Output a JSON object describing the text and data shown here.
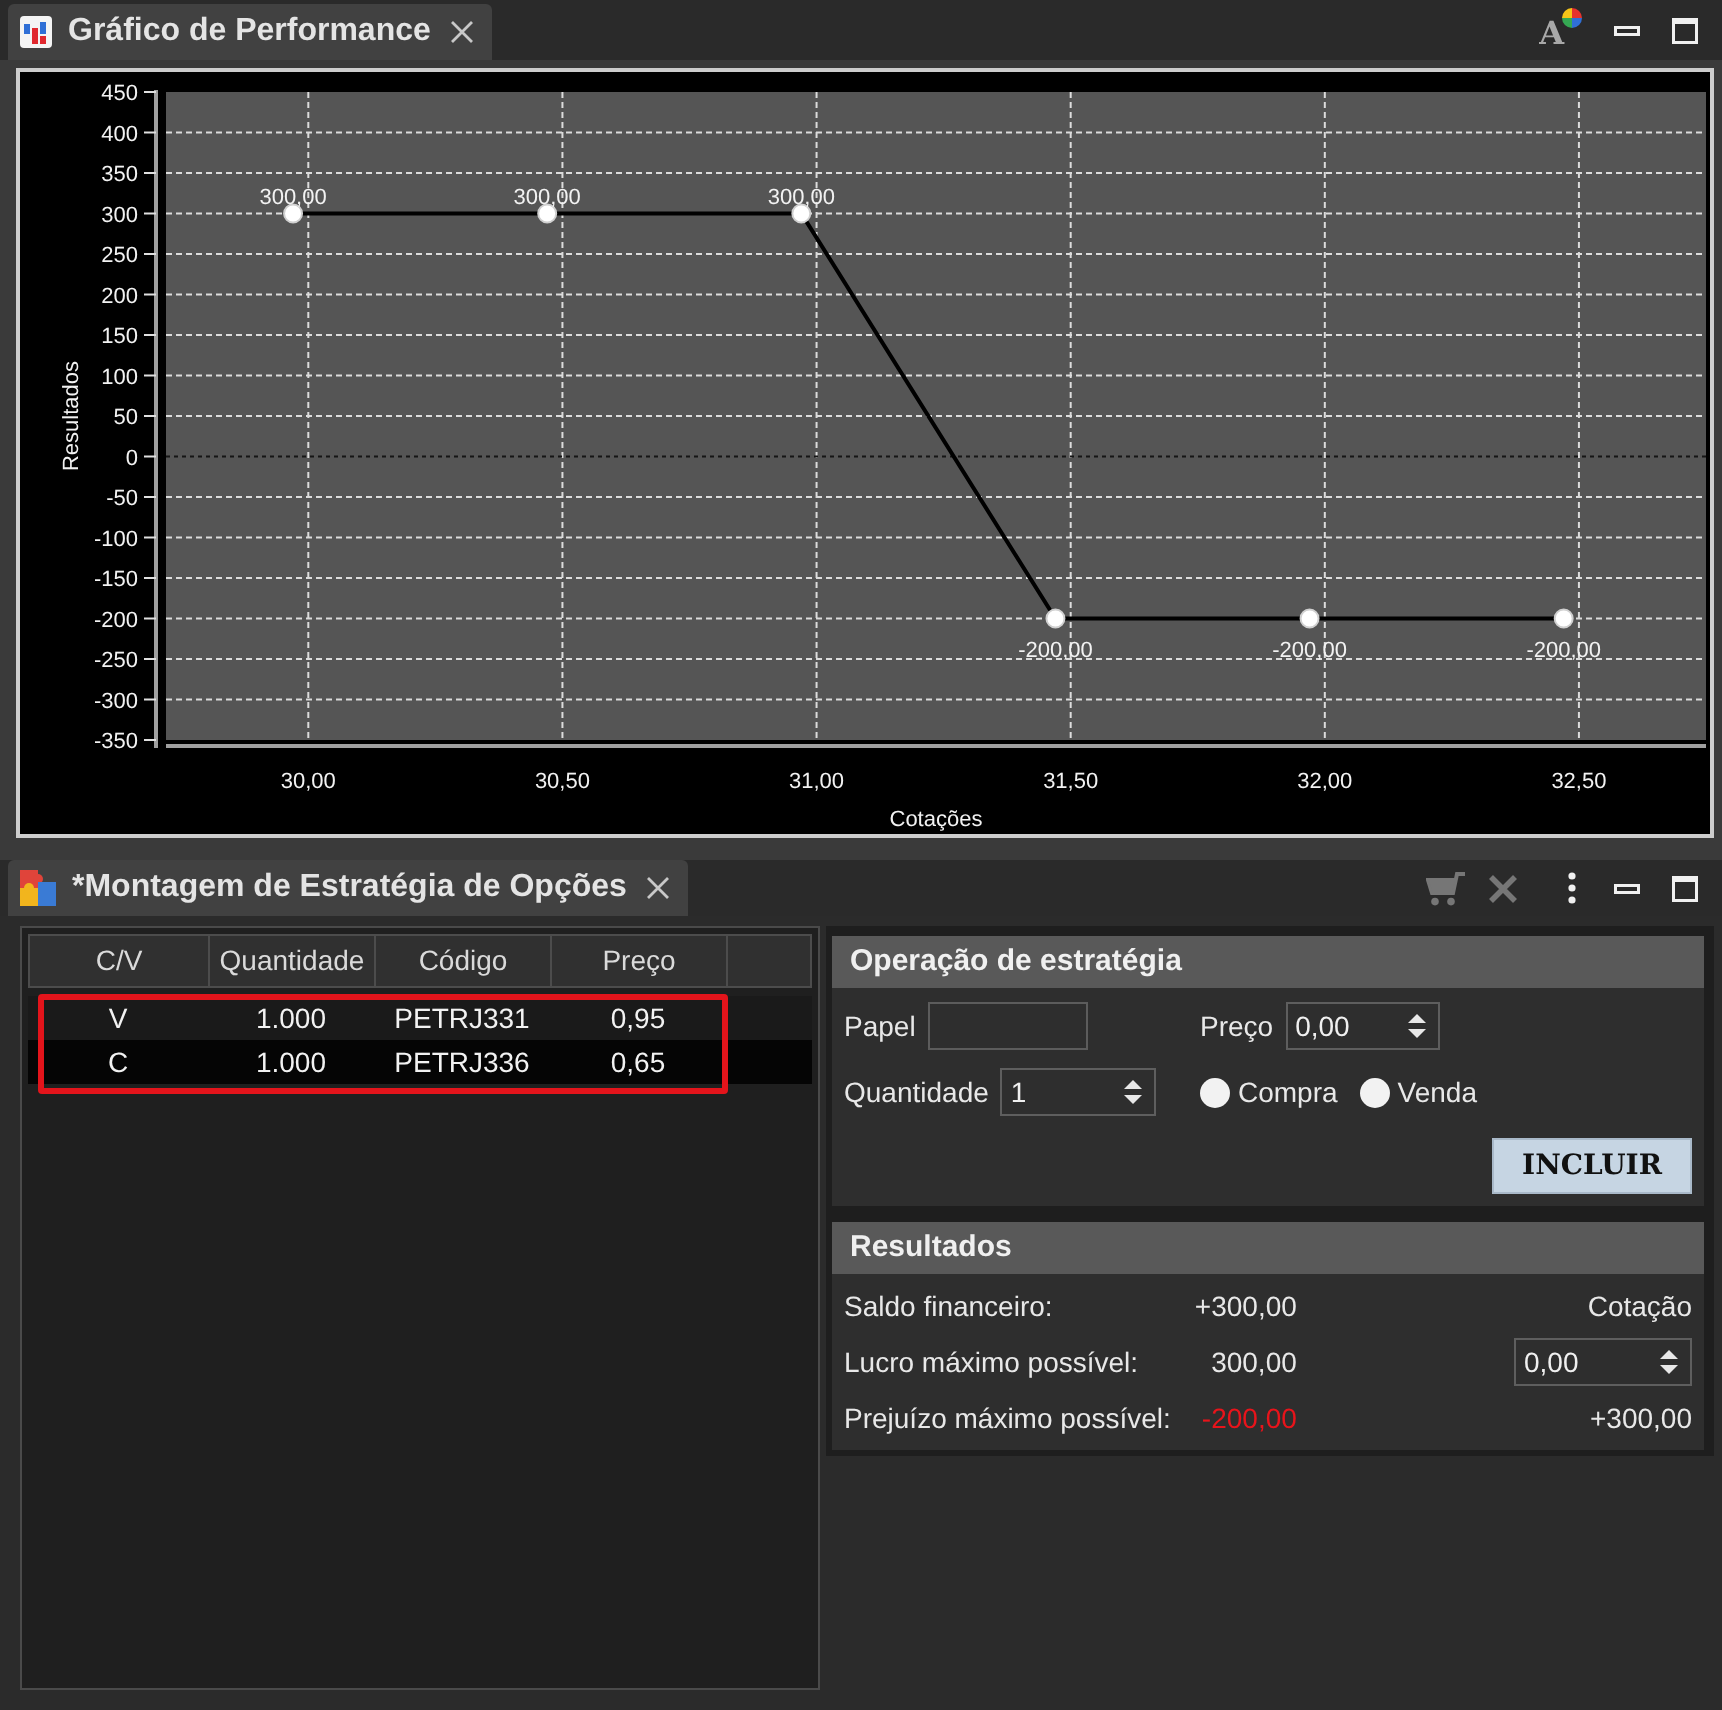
{
  "chart_view": {
    "tab_title": "Gráfico de Performance",
    "toolbar": [
      {
        "kind": "font",
        "glyph": "A",
        "disabled": false
      },
      {
        "kind": "minimize",
        "disabled": false
      },
      {
        "kind": "maximize",
        "disabled": false
      }
    ],
    "chart_data": {
      "type": "line",
      "xlabel": "Cotações",
      "ylabel": "Resultados",
      "grid": true,
      "x": [
        29.97,
        30.47,
        30.97,
        31.47,
        31.97,
        32.47
      ],
      "series": [
        {
          "color": "#000000",
          "marker": "circle",
          "values": [
            300,
            300,
            300,
            -200,
            -200,
            -200
          ]
        }
      ],
      "xlim": [
        29.72,
        32.75
      ],
      "ylim": [
        -350,
        450
      ],
      "xticks": [
        {
          "value": 30,
          "label": "30,00"
        },
        {
          "value": 30.5,
          "label": "30,50"
        },
        {
          "value": 31,
          "label": "31,00"
        },
        {
          "value": 31.5,
          "label": "31,50"
        },
        {
          "value": 32,
          "label": "32,00"
        },
        {
          "value": 32.5,
          "label": "32,50"
        }
      ],
      "yticks": [
        450,
        400,
        350,
        300,
        250,
        200,
        150,
        100,
        50,
        0,
        -50,
        -100,
        -150,
        -200,
        -250,
        -300,
        -350
      ],
      "ref_lines": [
        {
          "axis": "y",
          "value": 0,
          "color": "#151515"
        }
      ],
      "value_labels": [
        "300,00",
        "300,00",
        "300,00",
        "-200,00",
        "-200,00",
        "-200,00"
      ]
    }
  },
  "strategy_view": {
    "tab_title": "*Montagem de Estratégia de Opções",
    "toolbar": [
      {
        "kind": "cart",
        "disabled": true
      },
      {
        "kind": "close",
        "disabled": true
      },
      {
        "kind": "more",
        "disabled": false
      },
      {
        "kind": "minimize",
        "disabled": false
      },
      {
        "kind": "maximize",
        "disabled": false
      }
    ],
    "table": {
      "columns": [
        "C/V",
        "Quantidade",
        "Código",
        "Preço"
      ],
      "rows": [
        {
          "cells": [
            "V",
            "1.000",
            "PETRJ331",
            "0,95"
          ],
          "highlighted": true
        },
        {
          "cells": [
            "C",
            "1.000",
            "PETRJ336",
            "0,65"
          ],
          "highlighted": true
        }
      ]
    },
    "operation": {
      "title": "Operação de estratégia",
      "papel": {
        "label": "Papel"
      },
      "preco": {
        "label": "Preço",
        "value": "0,00"
      },
      "quantidade": {
        "label": "Quantidade",
        "value": "1"
      },
      "options": [
        {
          "label": "Compra",
          "selected": false
        },
        {
          "label": "Venda",
          "selected": false
        }
      ],
      "button": "INCLUIR"
    },
    "results": {
      "title": "Resultados",
      "rows": [
        {
          "label": "Saldo financeiro:",
          "value": "+300,00",
          "negative": false
        },
        {
          "label": "Lucro máximo possível:",
          "value": "300,00",
          "negative": false
        },
        {
          "label": "Prejuízo máximo possível:",
          "value": "-200,00",
          "negative": true
        }
      ],
      "cotacao": {
        "label": "Cotação",
        "value": "0,00",
        "result": "+300,00"
      }
    }
  }
}
